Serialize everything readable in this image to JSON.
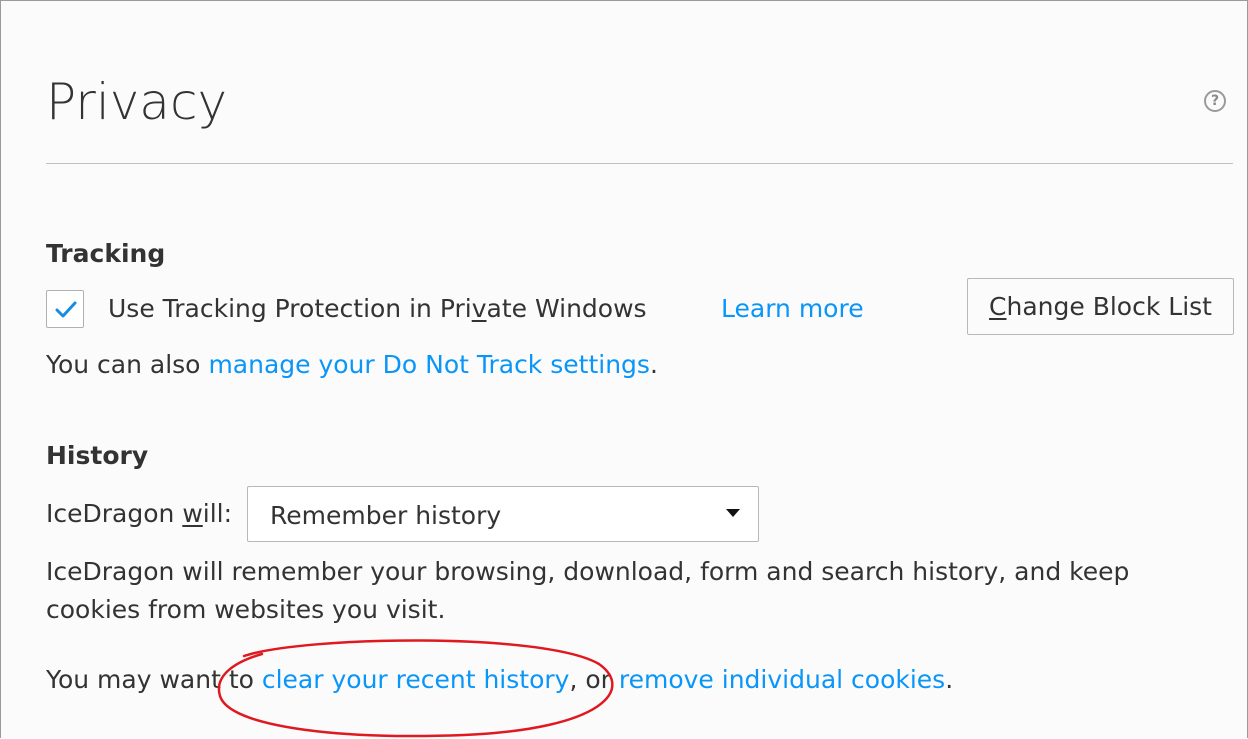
{
  "page": {
    "title": "Privacy",
    "help_icon": "question-circle-icon"
  },
  "tracking": {
    "heading": "Tracking",
    "checkbox_checked": true,
    "checkbox_label_pre": "Use Tracking Protection in Pri",
    "checkbox_label_accel": "v",
    "checkbox_label_post": "ate Windows",
    "learn_more": "Learn more",
    "change_block_list_accel": "C",
    "change_block_list_rest": "hange Block List",
    "dnt_prefix": "You can also ",
    "dnt_link": "manage your Do Not Track settings",
    "dnt_suffix": "."
  },
  "history": {
    "heading": "History",
    "will_label_pre": "IceDragon ",
    "will_label_accel": "w",
    "will_label_post": "ill:",
    "select_value": "Remember history",
    "description_line1": "IceDragon will remember your browsing, download, form and search history, and keep",
    "description_line2": "cookies from websites you visit.",
    "clear_prefix": "You may want to ",
    "clear_link": "clear your recent history",
    "clear_middle": ", or ",
    "cookies_link": "remove individual cookies",
    "clear_suffix": "."
  },
  "colors": {
    "link": "#0996f8",
    "annotation": "#e0181f",
    "text": "#333333"
  }
}
